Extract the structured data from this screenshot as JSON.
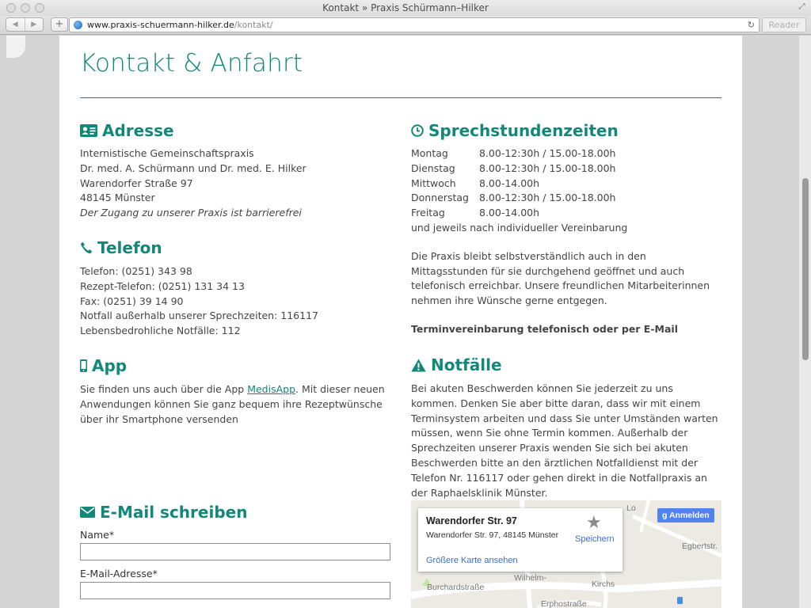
{
  "window": {
    "title": "Kontakt » Praxis Schürmann–Hilker"
  },
  "toolbar": {
    "url_host": "www.praxis-schuermann-hilker.de",
    "url_path": "/kontakt/",
    "reader_label": "Reader",
    "back_glyph": "◀",
    "forward_glyph": "▶",
    "newtab_glyph": "+",
    "reload_glyph": "↻"
  },
  "page": {
    "title": "Kontakt & Anfahrt",
    "accent_color": "#138779"
  },
  "address": {
    "heading": "Adresse",
    "icon": "address-card-icon",
    "lines": [
      "Internistische Gemeinschaftspraxis",
      "Dr. med. A. Schürmann und Dr. med. E. Hilker",
      "Warendorfer Straße 97",
      "48145 Münster"
    ],
    "note": "Der Zugang zu unserer Praxis ist barrierefrei"
  },
  "phone": {
    "heading": "Telefon",
    "icon": "phone-icon",
    "lines": [
      "Telefon: (0251) 343 98",
      "Rezept-Telefon: (0251) 131 34 13",
      "Fax: (0251) 39 14 90",
      "Notfall außerhalb unserer Sprechzeiten: 116117",
      "Lebensbedrohliche Notfälle: 112"
    ]
  },
  "app": {
    "heading": "App",
    "icon": "mobile-phone-icon",
    "text_before": "Sie finden uns auch über die App ",
    "link": "MedisApp",
    "text_after": ". Mit dieser neuen Anwendungen können Sie ganz bequem ihre Rezeptwünsche über ihr Smartphone versenden"
  },
  "hours": {
    "heading": "Sprechstundenzeiten",
    "icon": "clock-icon",
    "rows": [
      {
        "day": "Montag",
        "time": "8.00-12:30h / 15.00-18.00h"
      },
      {
        "day": "Dienstag",
        "time": "8.00-12:30h / 15.00-18.00h"
      },
      {
        "day": "Mittwoch",
        "time": "8.00-14.00h"
      },
      {
        "day": "Donnerstag",
        "time": "8.00-12:30h / 15.00-18.00h"
      },
      {
        "day": "Freitag",
        "time": "8.00-14.00h"
      }
    ],
    "extra": "und jeweils nach individueller Vereinbarung",
    "paragraph": "Die Praxis bleibt selbstverständlich auch in den Mittagsstunden für sie durchgehend geöffnet und auch telefonisch erreichbar. Unsere freundlichen Mitarbeiterinnen nehmen ihre Wünsche gerne entgegen.",
    "appointment": "Terminvereinbarung telefonisch oder per E-Mail"
  },
  "emergency": {
    "heading": "Notfälle",
    "icon": "warning-triangle-icon",
    "text": "Bei akuten Beschwerden können Sie jederzeit zu uns kommen. Denken Sie aber bitte daran, dass wir mit einem Terminsystem arbeiten und dass Sie unter Umständen warten müssen, wenn Sie ohne Termin kommen. Außerhalb der Sprechzeiten unserer Praxis wenden Sie sich bei akuten Beschwerden bitte an den ärztlichen Notfalldienst mit der Telefon Nr. 116117 oder gehen direkt in die Notfallpraxis an der Raphaelsklinik Münster."
  },
  "email": {
    "heading": "E-Mail schreiben",
    "icon": "envelope-icon",
    "name_label": "Name*",
    "email_label": "E-Mail-Adresse*"
  },
  "map": {
    "card_title": "Warendorfer Str. 97",
    "card_address": "Warendorfer Str. 97, 48145 Münster",
    "save_label": "Speichern",
    "larger_map_label": "Größere Karte ansehen",
    "signin_label": "Anmelden",
    "streets": [
      "Egbertstr.",
      "Burchardstraße",
      "Erphostraße",
      "Wilhelm-",
      "Kirchs",
      "Lo"
    ]
  }
}
